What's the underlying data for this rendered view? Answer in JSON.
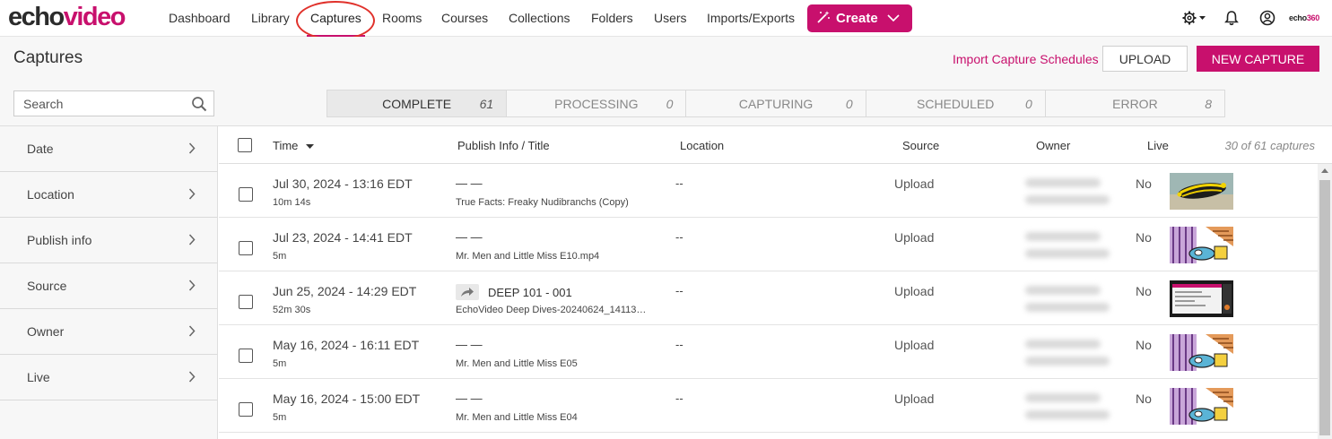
{
  "nav": {
    "logo_part1": "echo",
    "logo_part2": "video",
    "links": [
      "Dashboard",
      "Library",
      "Captures",
      "Rooms",
      "Courses",
      "Collections",
      "Folders",
      "Users",
      "Imports/Exports"
    ],
    "active": "Captures",
    "create_label": "Create",
    "brand_small_part1": "echo",
    "brand_small_part2": "360",
    "icons": [
      "settings-icon",
      "bell-icon",
      "user-icon"
    ]
  },
  "header": {
    "title": "Captures",
    "import_link": "Import Capture Schedules",
    "upload_label": "UPLOAD",
    "new_capture_label": "NEW CAPTURE"
  },
  "search": {
    "placeholder": "Search"
  },
  "status_tabs": [
    {
      "label": "COMPLETE",
      "count": "61"
    },
    {
      "label": "PROCESSING",
      "count": "0"
    },
    {
      "label": "CAPTURING",
      "count": "0"
    },
    {
      "label": "SCHEDULED",
      "count": "0"
    },
    {
      "label": "ERROR",
      "count": "8"
    }
  ],
  "sidebar": {
    "items": [
      {
        "label": "Date"
      },
      {
        "label": "Location"
      },
      {
        "label": "Publish info"
      },
      {
        "label": "Source"
      },
      {
        "label": "Owner"
      },
      {
        "label": "Live"
      }
    ]
  },
  "table": {
    "columns": {
      "time": "Time",
      "publish": "Publish Info / Title",
      "location": "Location",
      "source": "Source",
      "owner": "Owner",
      "live": "Live"
    },
    "count_text": "30 of 61 captures",
    "rows": [
      {
        "time": "Jul 30, 2024 - 13:16 EDT",
        "duration": "10m 14s",
        "publish": "— —",
        "title": "True Facts: Freaky Nudibranchs (Copy)",
        "location": "--",
        "source": "Upload",
        "live": "No",
        "thumb": "nudibranch"
      },
      {
        "time": "Jul 23, 2024 - 14:41 EDT",
        "duration": "5m",
        "publish": "— —",
        "title": "Mr. Men and Little Miss E10.mp4",
        "location": "--",
        "source": "Upload",
        "live": "No",
        "thumb": "cartoon"
      },
      {
        "time": "Jun 25, 2024 - 14:29 EDT",
        "duration": "52m 30s",
        "publish": "DEEP 101 - 001",
        "title": "EchoVideo Deep Dives-20240624_14113…",
        "location": "--",
        "source": "Upload",
        "live": "No",
        "thumb": "screen"
      },
      {
        "time": "May 16, 2024 - 16:11 EDT",
        "duration": "5m",
        "publish": "— —",
        "title": "Mr. Men and Little Miss E05",
        "location": "--",
        "source": "Upload",
        "live": "No",
        "thumb": "cartoon"
      },
      {
        "time": "May 16, 2024 - 15:00 EDT",
        "duration": "5m",
        "publish": "— —",
        "title": "Mr. Men and Little Miss E04",
        "location": "--",
        "source": "Upload",
        "live": "No",
        "thumb": "cartoon"
      }
    ]
  },
  "colors": {
    "accent": "#c8106d",
    "annotation_circle": "#e0312b"
  }
}
